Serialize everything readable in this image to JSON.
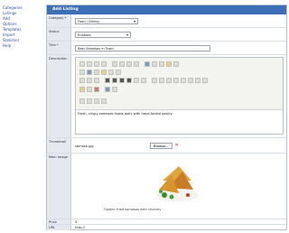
{
  "sidebar": {
    "links": [
      "Categories",
      "Listings",
      "Add",
      "Options",
      "Templates",
      "Import",
      "Statistics",
      "Help"
    ]
  },
  "panel": {
    "title": "Add Listing"
  },
  "form": {
    "category": {
      "label": "Category *",
      "value": "Food / Dining"
    },
    "status": {
      "label": "Status",
      "value": "Enabled"
    },
    "title": {
      "label": "Title *",
      "value": "Best Samosas in Town"
    },
    "description": {
      "label": "Description",
      "text": "Fresh, crispy samosas made daily with hand-folded pastry."
    },
    "thumbnail": {
      "label": "Thumbnail",
      "value": "samosa.jpg",
      "browse_label": "Browse...",
      "clear_glyph": "✕"
    },
    "image": {
      "label": "Main Image",
      "caption": "Golden fried samosas with chutney"
    },
    "price": {
      "label": "Price",
      "value": "3"
    },
    "url": {
      "label": "URL",
      "value": "http://"
    }
  },
  "colors": {
    "titlebar": "#3d6fb6",
    "label_bg": "#e4e9f0",
    "link": "#2a4f9e"
  },
  "icons": {
    "toolbar": "editor-toolbar-icons",
    "preview": "samosa-photo"
  }
}
